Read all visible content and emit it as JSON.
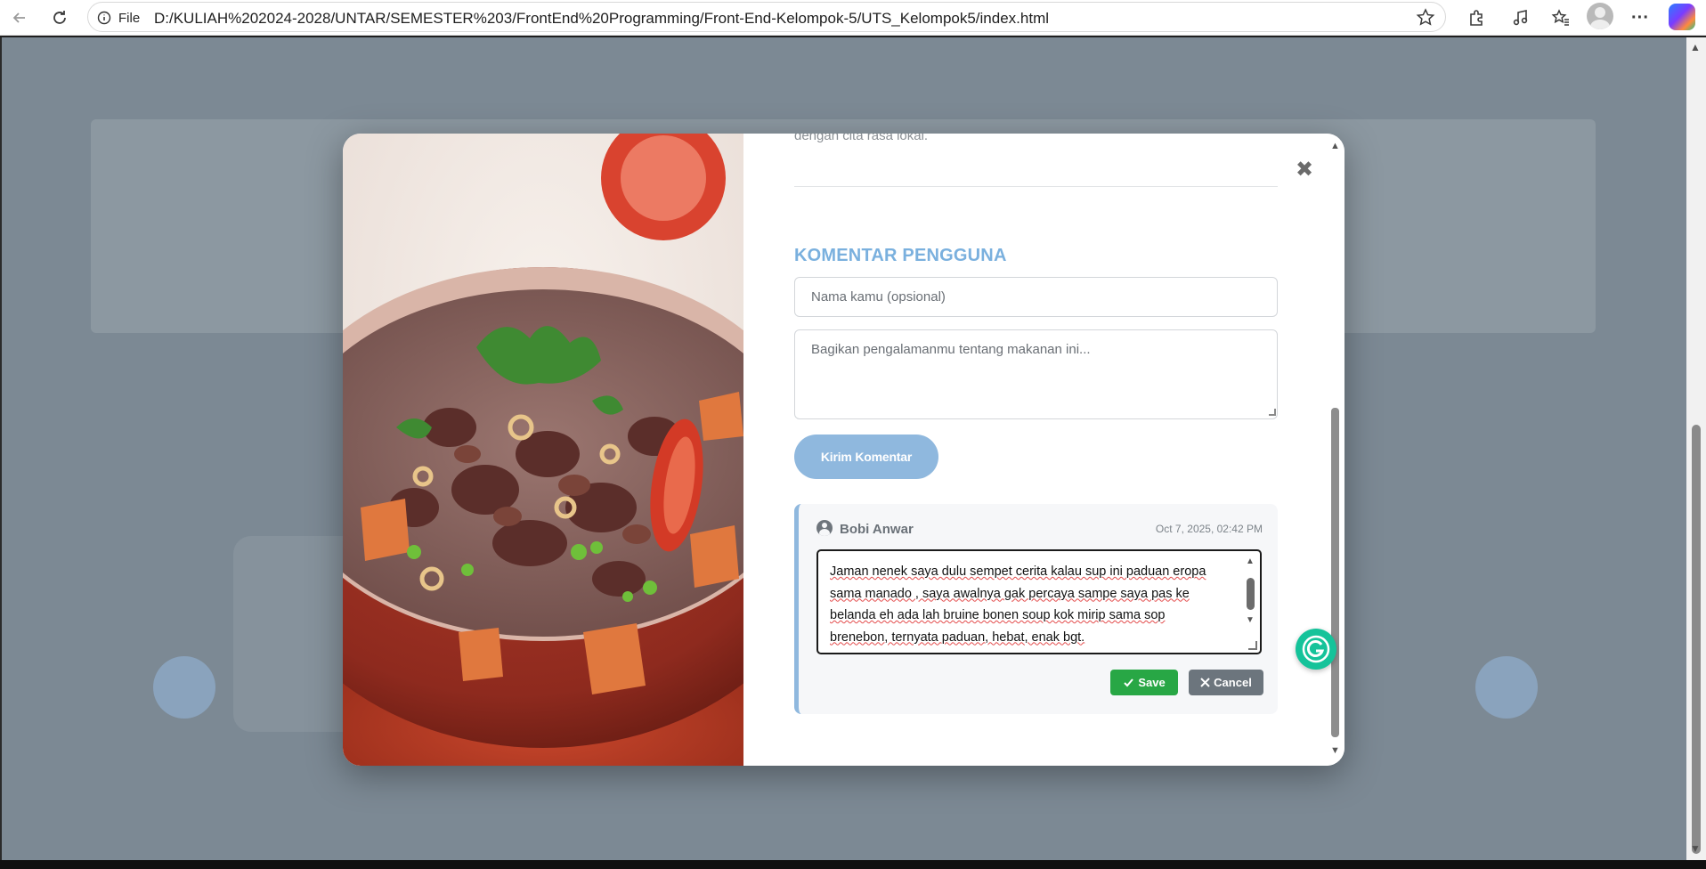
{
  "browser": {
    "file_label": "File",
    "url": "D:/KULIAH%202024-2028/UNTAR/SEMESTER%203/FrontEnd%20Programming/Front-End-Kelompok-5/UTS_Kelompok5/index.html"
  },
  "modal": {
    "description_tail": "dengan cita rasa lokal.",
    "section_title": "KOMENTAR PENGGUNA",
    "name_placeholder": "Nama kamu (opsional)",
    "message_placeholder": "Bagikan pengalamanmu tentang makanan ini...",
    "send_label": "Kirim Komentar",
    "comment": {
      "author": "Bobi Anwar",
      "date": "Oct 7, 2025, 02:42 PM",
      "text_lines": [
        "Jaman nenek saya dulu sempet cerita kalau sup ini paduan eropa",
        "sama manado , saya awalnya gak percaya sampe saya pas ke",
        "belanda eh ada lah bruine bonen soup kok mirip sama sop",
        "brenebon, ternyata paduan, hebat, enak bgt."
      ],
      "save_label": "Save",
      "cancel_label": "Cancel"
    }
  },
  "colors": {
    "accent": "#7ab0de",
    "save": "#28a745",
    "cancel": "#6c757d",
    "grammarly": "#15c39a"
  },
  "icons": [
    "back-icon",
    "reload-icon",
    "info-icon",
    "star-icon",
    "extensions-icon",
    "music-icon",
    "favorites-icon",
    "profile-icon",
    "more-icon",
    "copilot-icon",
    "close-icon",
    "user-circle-icon",
    "check-icon",
    "x-icon",
    "grammarly-icon"
  ]
}
